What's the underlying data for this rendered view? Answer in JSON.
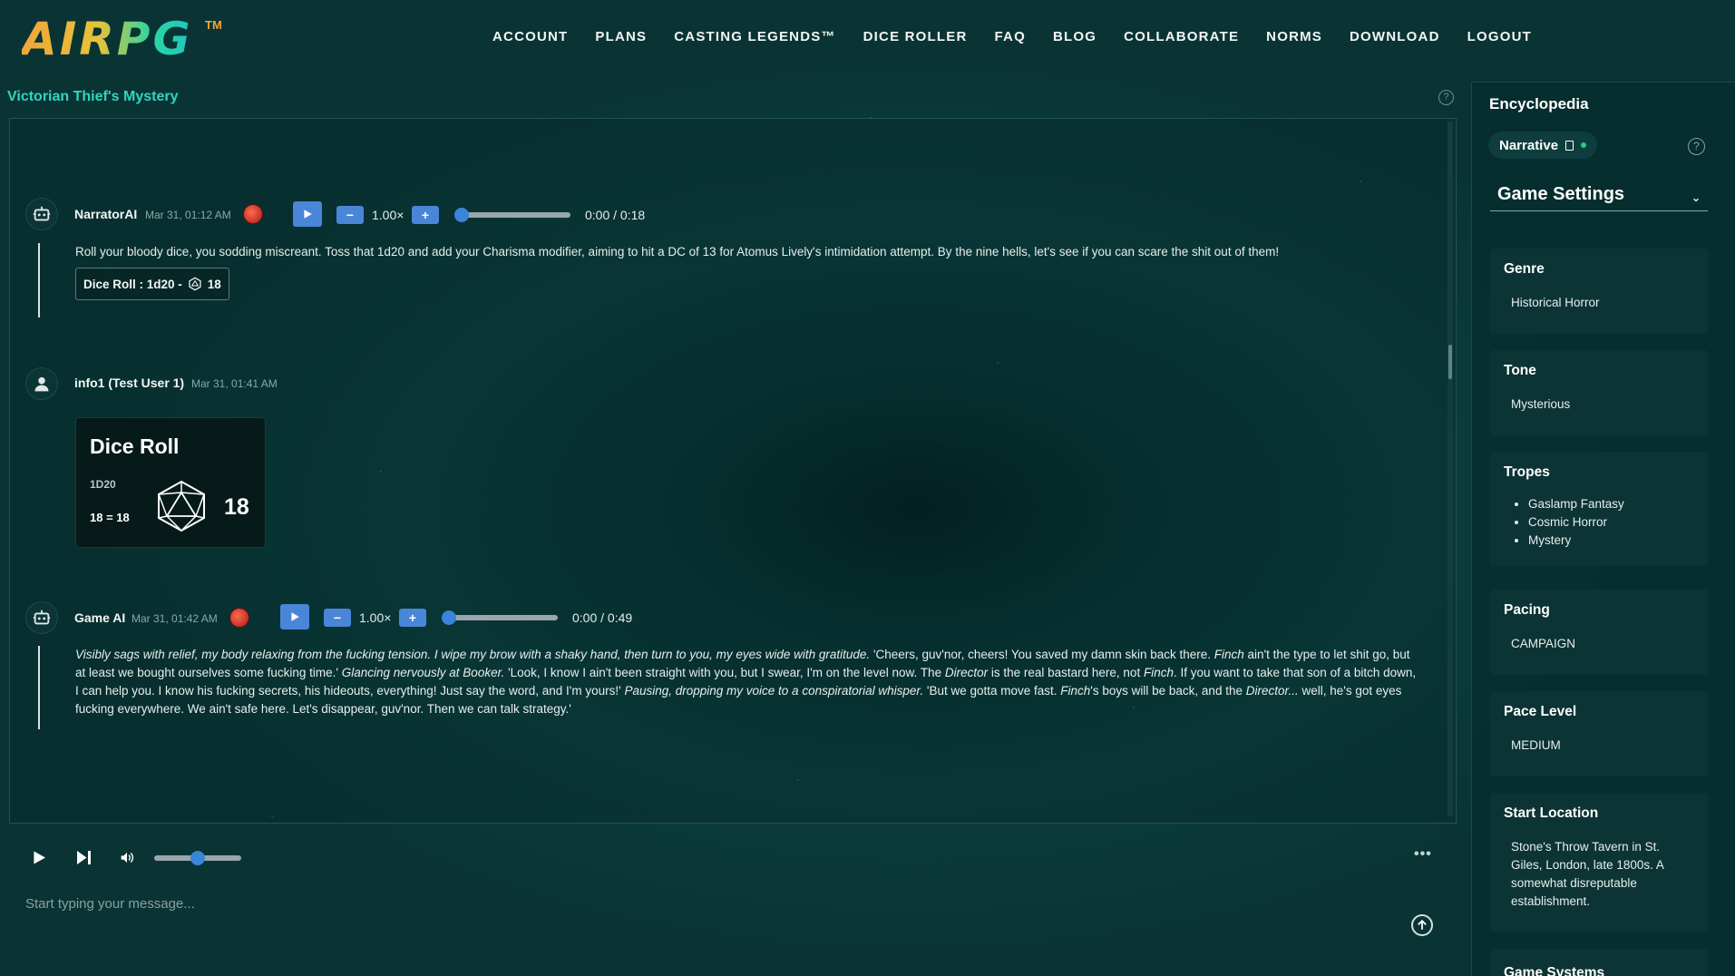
{
  "app": {
    "logo": "AIRPG",
    "logo_tm": "TM"
  },
  "nav": [
    "ACCOUNT",
    "PLANS",
    "CASTING LEGENDS™",
    "DICE ROLLER",
    "FAQ",
    "BLOG",
    "COLLABORATE",
    "NORMS",
    "DOWNLOAD",
    "LOGOUT"
  ],
  "game_title": "Victorian Thief's Mystery",
  "messages": {
    "m1": {
      "author": "NarratorAI",
      "time": "Mar 31, 01:12 AM",
      "speed": "1.00×",
      "duration": "0:00 / 0:18",
      "text": "Roll your bloody dice, you sodding miscreant. Toss that 1d20 and add your Charisma modifier, aiming to hit a DC of 13 for Atomus Lively's intimidation attempt. By the nine hells, let's see if you can scare the shit out of them!",
      "dice_chip_label": "Dice Roll : 1d20 -",
      "dice_chip_value": "18"
    },
    "m2": {
      "author": "info1 (Test User 1)",
      "time": "Mar 31, 01:41 AM",
      "card_title": "Dice Roll",
      "card_kind": "1D20",
      "card_eq": "18 = 18",
      "card_result": "18"
    },
    "m3": {
      "author": "Game AI",
      "time": "Mar 31, 01:42 AM",
      "speed": "1.00×",
      "duration": "0:00 / 0:49",
      "p1i": "Visibly sags with relief, my body relaxing from the fucking tension. I wipe my brow with a shaky hand, then turn to you, my eyes wide with gratitude.",
      "p1": " 'Cheers, guv'nor, cheers! You saved my damn skin back there. ",
      "finch": "Finch",
      "p2": " ain't the type to let shit go, but at least we bought ourselves some fucking time.' ",
      "p2i": "Glancing nervously at Booker.",
      "p3": " 'Look, I know I ain't been straight with you, but I swear, I'm on the level now. The ",
      "director": "Director",
      "p4": " is the real bastard here, not ",
      "p5": ". If you want to take that son of a bitch down, I can help you. I know his fucking secrets, his hideouts, everything! Just say the word, and I'm yours!' ",
      "p5i": "Pausing, dropping my voice to a conspiratorial whisper.",
      "p6": " 'But we gotta move fast. ",
      "p7": "'s boys will be back, and the ",
      "director2": "Director...",
      "p8": " well, he's got eyes fucking everywhere. We ain't safe here. Let's disappear, guv'nor. Then we can talk strategy.'"
    }
  },
  "input": {
    "placeholder": "Start typing your message..."
  },
  "player": {
    "volume_level": 0.5
  },
  "sidebar": {
    "title": "Encyclopedia",
    "narrative_tab": "Narrative",
    "section": "Game Settings",
    "cards": {
      "genre": {
        "label": "Genre",
        "value": "Historical Horror"
      },
      "tone": {
        "label": "Tone",
        "value": "Mysterious"
      },
      "tropes": {
        "label": "Tropes",
        "items": [
          "Gaslamp Fantasy",
          "Cosmic Horror",
          "Mystery"
        ]
      },
      "pacing": {
        "label": "Pacing",
        "value": "CAMPAIGN"
      },
      "pace_level": {
        "label": "Pace Level",
        "value": "MEDIUM"
      },
      "start_location": {
        "label": "Start Location",
        "value": "Stone's Throw Tavern in St. Giles, London, late 1800s. A somewhat disreputable establishment."
      },
      "next": {
        "label": "Game Systems"
      }
    }
  },
  "colors": {
    "accent_blue": "#4a86d8",
    "title_teal": "#2fd6c0",
    "background": "#0b3d3d"
  }
}
